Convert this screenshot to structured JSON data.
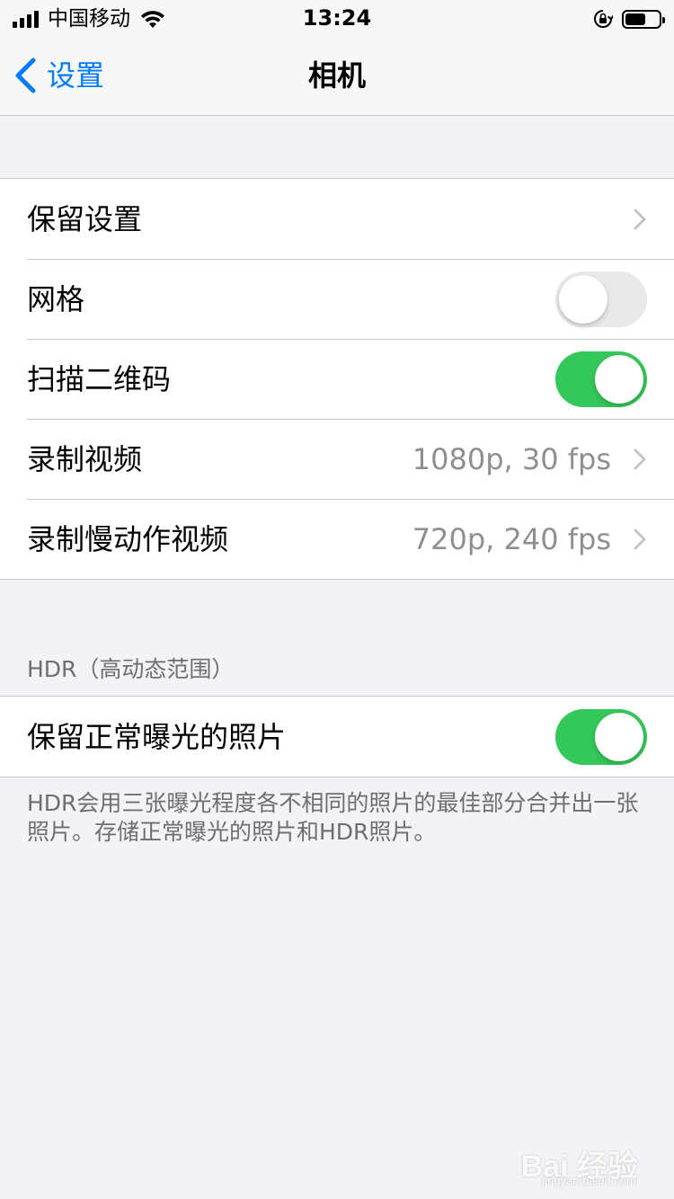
{
  "status_bar": {
    "carrier": "中国移动",
    "time": "13:24",
    "battery_level": 0.62
  },
  "nav": {
    "back_label": "设置",
    "title": "相机"
  },
  "group1": {
    "preserve_settings": "保留设置",
    "grid": {
      "label": "网格",
      "on": false
    },
    "scan_qr": {
      "label": "扫描二维码",
      "on": true
    },
    "record_video": {
      "label": "录制视频",
      "value": "1080p, 30 fps"
    },
    "record_slo_mo": {
      "label": "录制慢动作视频",
      "value": "720p, 240 fps"
    }
  },
  "hdr": {
    "header": "HDR（高动态范围）",
    "keep_normal": {
      "label": "保留正常曝光的照片",
      "on": true
    },
    "footer": "HDR会用三张曝光程度各不相同的照片的最佳部分合并出一张照片。存储正常曝光的照片和HDR照片。"
  },
  "watermark": {
    "text": "Bai 经验",
    "sub": "jingyan.baidu.com"
  },
  "colors": {
    "accent": "#007aff",
    "toggle_on": "#34c759",
    "toggle_off": "#e9e9ea"
  }
}
